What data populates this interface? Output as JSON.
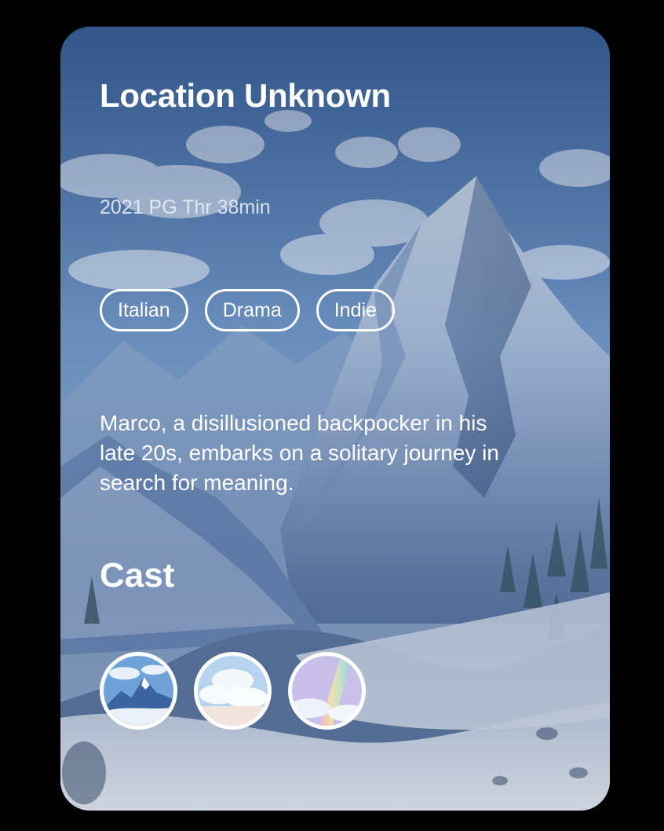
{
  "movie": {
    "title": "Location Unknown",
    "meta": "2021 PG Thr 38min",
    "tags": [
      "Italian",
      "Drama",
      "Indie"
    ],
    "description": "Marco, a disillusioned backpocker in his late 20s, embarks on a solitary journey in search for meaning."
  },
  "cast": {
    "heading": "Cast",
    "avatars": [
      "mountain-avatar",
      "clouds-avatar",
      "rainbow-avatar"
    ]
  },
  "background": {
    "icon": "mountain-landscape-image"
  }
}
